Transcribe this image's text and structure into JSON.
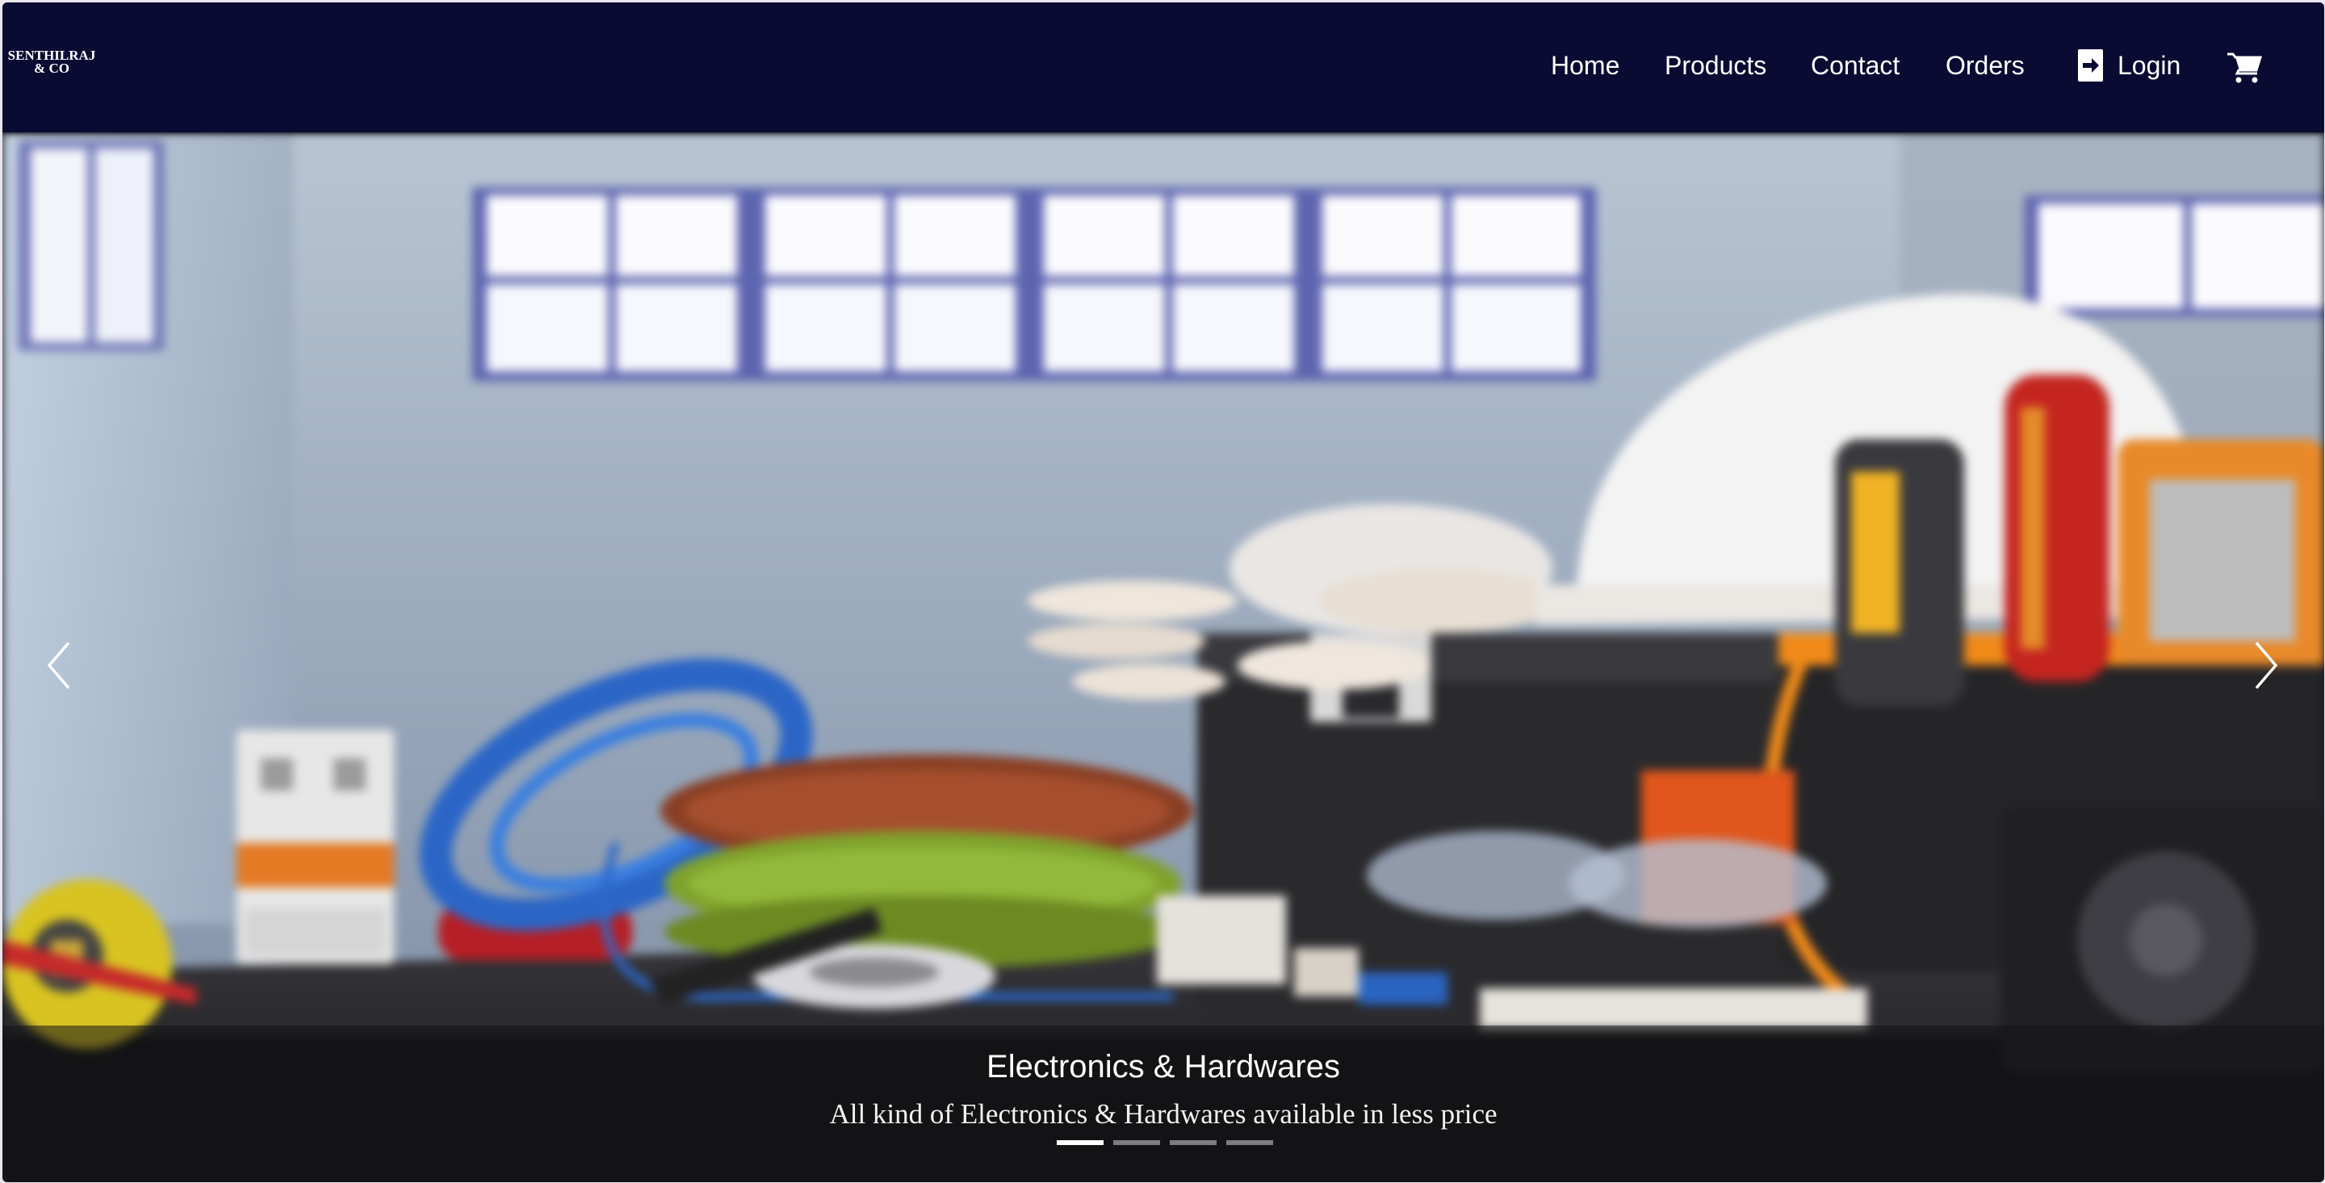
{
  "brand": {
    "line1": "SENTHILRAJ",
    "line2": "& CO"
  },
  "nav": {
    "home": "Home",
    "products": "Products",
    "contact": "Contact",
    "orders": "Orders",
    "login": "Login",
    "login_icon": "sign-in-icon",
    "cart_icon": "shopping-cart-icon"
  },
  "carousel": {
    "caption_title": "Electronics & Hardwares",
    "caption_text": "All kind of Electronics & Hardwares available in less price",
    "slides_count": 4,
    "active_slide": 1,
    "prev_icon": "chevron-left-icon",
    "next_icon": "chevron-right-icon"
  },
  "colors": {
    "navbar": "#0a0b33",
    "nav_text": "#ffffff"
  }
}
